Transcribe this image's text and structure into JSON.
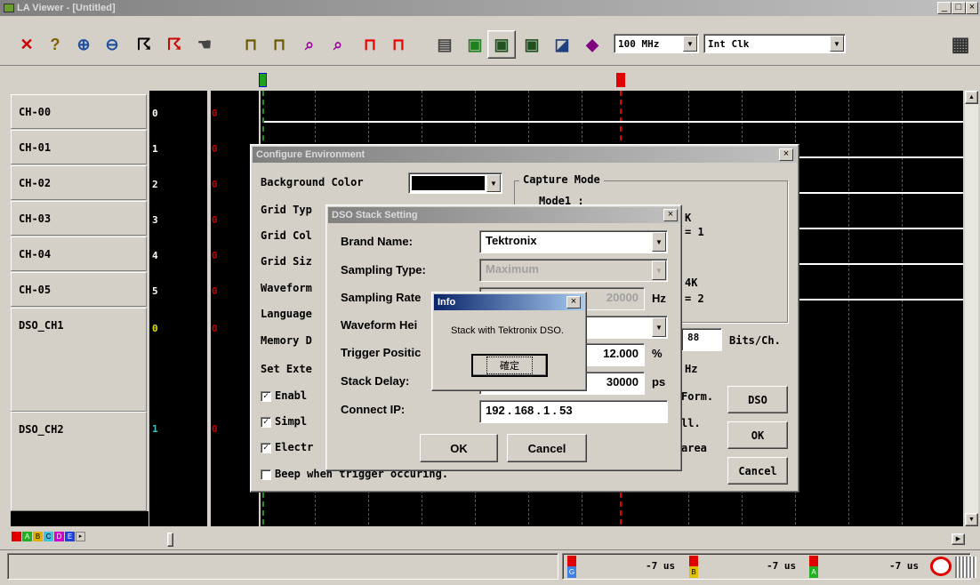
{
  "app": {
    "title": "LA Viewer - [Untitled]",
    "window_controls": [
      "_",
      "□",
      "×"
    ]
  },
  "toolbar": {
    "icons": [
      "wrench-icon",
      "help-icon",
      "zoom-in-icon",
      "zoom-out-icon",
      "run-icon",
      "run-stop-icon",
      "hand-icon",
      "trigger-icon",
      "value-icon",
      "search-wave-icon",
      "search-wave2-icon",
      "pulse-icon",
      "pattern-icon",
      "printer-icon",
      "module-icon",
      "monitor-icon",
      "monitor2-icon",
      "window-icon",
      "book-icon",
      "chip-icon"
    ],
    "freq_value": "100 MHz",
    "clock_value": "Int Clk"
  },
  "channels": [
    {
      "label": "CH-00",
      "num": "0",
      "val": "0"
    },
    {
      "label": "CH-01",
      "num": "1",
      "val": "0"
    },
    {
      "label": "CH-02",
      "num": "2",
      "val": "0"
    },
    {
      "label": "CH-03",
      "num": "3",
      "val": "0"
    },
    {
      "label": "CH-04",
      "num": "4",
      "val": "0"
    },
    {
      "label": "CH-05",
      "num": "5",
      "val": "0"
    },
    {
      "label": "DSO_CH1",
      "num": "0",
      "val": "0"
    },
    {
      "label": "DSO_CH2",
      "num": "1",
      "val": "0"
    }
  ],
  "status": {
    "markers": [
      "G",
      "B",
      "A"
    ],
    "times": [
      "-7 us",
      "-7 us",
      "-7 us"
    ],
    "color_marks": [
      "A",
      "B",
      "C",
      "D",
      "E"
    ]
  },
  "configure": {
    "title": "Configure Environment",
    "bg_color_label": "Background Color",
    "grid_type_label": "Grid Typ",
    "grid_color_label": "Grid Col",
    "grid_size_label": "Grid Siz",
    "waveform_label": "Waveform",
    "language_label": "Language",
    "memory_label": "Memory D",
    "set_ext_label": "Set Exte",
    "enable_label": "Enabl",
    "simple_label": "Simpl",
    "electric_label": "Electr",
    "beep_label": "Beep when trigger occuring.",
    "capture_mode_label": "Capture Mode",
    "mode1_label": "Mode1 :",
    "k_frag1": "K",
    "eq1": "= 1",
    "k_frag2": "4K",
    "eq2": "= 2",
    "bits_value": "88",
    "bits_label": "Bits/Ch.",
    "hz_frag": "Hz",
    "form_frag": "Form.",
    "ll_frag": "ll.",
    "area_frag": "area",
    "dso_button": "DSO",
    "ok_button": "OK",
    "cancel_button": "Cancel"
  },
  "dso": {
    "title": "DSO Stack Setting",
    "brand_label": "Brand Name:",
    "brand_value": "Tektronix",
    "sampling_type_label": "Sampling Type:",
    "sampling_type_value": "Maximum",
    "sampling_rate_label": "Sampling Rate",
    "sampling_rate_value": "20000",
    "sampling_rate_unit": "Hz",
    "waveform_height_label": "Waveform Hei",
    "trigger_position_label": "Trigger Positic",
    "trigger_position_value": "12.000",
    "trigger_position_unit": "%",
    "stack_delay_label": "Stack Delay:",
    "stack_delay_value": "30000",
    "stack_delay_unit": "ps",
    "connect_ip_label": "Connect IP:",
    "ip_value": "192 . 168 . 1 . 53",
    "ok_button": "OK",
    "cancel_button": "Cancel"
  },
  "info": {
    "title": "Info",
    "message": "Stack with Tektronix DSO.",
    "ok_button": "確定"
  }
}
